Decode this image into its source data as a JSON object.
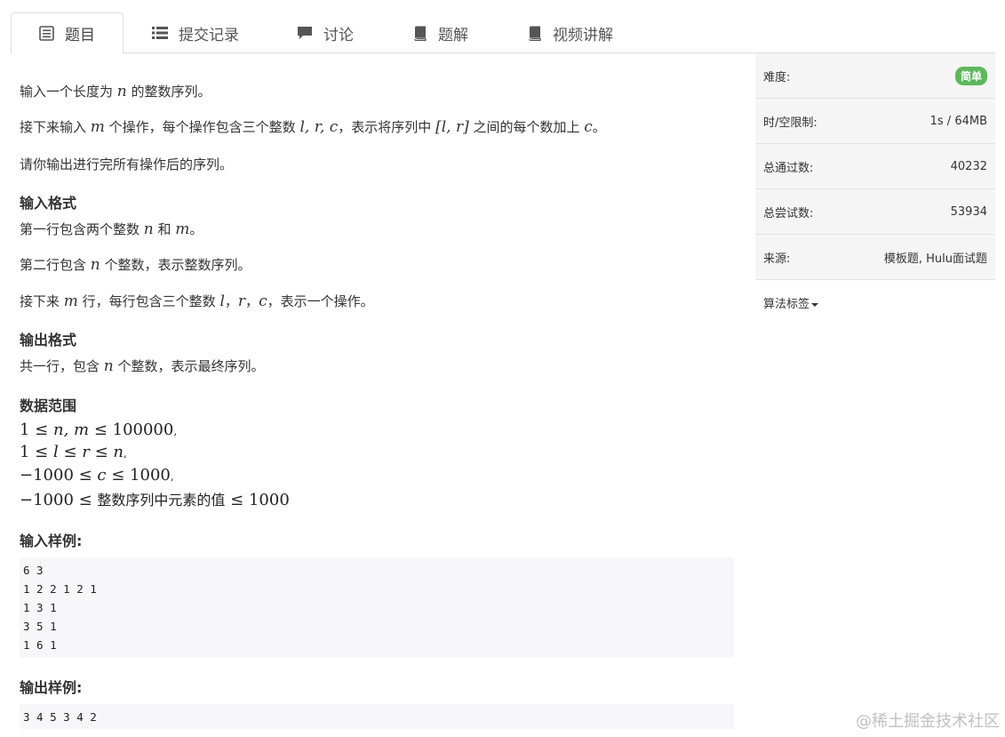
{
  "tabs": [
    {
      "label": "题目",
      "icon": "list-alt-icon",
      "active": true
    },
    {
      "label": "提交记录",
      "icon": "list-icon",
      "active": false
    },
    {
      "label": "讨论",
      "icon": "comment-icon",
      "active": false
    },
    {
      "label": "题解",
      "icon": "book-icon",
      "active": false
    },
    {
      "label": "视频讲解",
      "icon": "book-icon",
      "active": false
    }
  ],
  "problem": {
    "desc1": {
      "a": "输入一个长度为 ",
      "v1": "n",
      "b": " 的整数序列。"
    },
    "desc2": {
      "a": "接下来输入 ",
      "v1": "m",
      "b": " 个操作，每个操作包含三个整数 ",
      "v2": "l, r, c",
      "c": "，表示将序列中 ",
      "v3": "[l, r]",
      "d": " 之间的每个数加上 ",
      "v4": "c",
      "e": "。"
    },
    "desc3": "请你输出进行完所有操作后的序列。",
    "input_format_title": "输入格式",
    "if1": {
      "a": "第一行包含两个整数 ",
      "v1": "n",
      "b": " 和 ",
      "v2": "m",
      "c": "。"
    },
    "if2": {
      "a": "第二行包含 ",
      "v1": "n",
      "b": " 个整数，表示整数序列。"
    },
    "if3": {
      "a": "接下来 ",
      "v1": "m",
      "b": " 行，每行包含三个整数 ",
      "v2": "l",
      "c": "，",
      "v3": "r",
      "d": "，",
      "v4": "c",
      "e": "，表示一个操作。"
    },
    "output_format_title": "输出格式",
    "of1": {
      "a": "共一行，包含 ",
      "v1": "n",
      "b": " 个整数，表示最终序列。"
    },
    "range_title": "数据范围",
    "range1": {
      "a": "1 ≤ ",
      "v": "n, m",
      "b": " ≤ 100000",
      "c": ","
    },
    "range2": {
      "a": "1 ≤ ",
      "v1": "l",
      "b": " ≤ ",
      "v2": "r",
      "c": " ≤ ",
      "v3": "n",
      "d": ","
    },
    "range3": {
      "a": "−1000 ≤ ",
      "v": "c",
      "b": " ≤ 1000",
      "c": ","
    },
    "range4": {
      "a": "−1000 ≤ ",
      "cn": "整数序列中元素的值",
      "b": " ≤ 1000"
    },
    "input_sample_title": "输入样例:",
    "input_sample": [
      "6 3",
      "1 2 2 1 2 1",
      "1 3 1",
      "3 5 1",
      "1 6 1"
    ],
    "output_sample_title": "输出样例:",
    "output_sample": [
      "3 4 5 3 4 2"
    ]
  },
  "sidebar": {
    "difficulty_label": "难度:",
    "difficulty_value": "简单",
    "difficulty_color": "#5cb85c",
    "limit_label": "时/空限制:",
    "limit_value": "1s / 64MB",
    "passed_label": "总通过数:",
    "passed_value": "40232",
    "tried_label": "总尝试数:",
    "tried_value": "53934",
    "source_label": "来源:",
    "source_value": "模板题, Hulu面试题",
    "tags_label": "算法标签"
  },
  "watermark": "@稀土掘金技术社区"
}
